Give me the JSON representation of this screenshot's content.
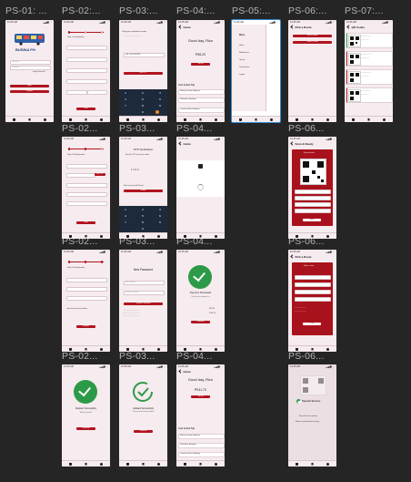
{
  "columns": [
    {
      "label": "PS-01: ..."
    },
    {
      "label": "PS-02:..."
    },
    {
      "label": "PS-03:..."
    },
    {
      "label": "PS-04:..."
    },
    {
      "label": "PS-05:..."
    },
    {
      "label": "PS-06:..."
    },
    {
      "label": "PS-07:..."
    }
  ],
  "row_labels": {
    "r2c2": "PS-02...",
    "r2c3": "PS-03...",
    "r2c4": "PS-04...",
    "r2c6": "PS-06...",
    "r3c2": "PS-02...",
    "r3c3": "PS-03...",
    "r3c4": "PS-04...",
    "r3c6": "PS-06...",
    "r4c2": "PS-02...",
    "r4c3": "PS-03...",
    "r4c4": "PS-04...",
    "r4c6": "PS-06..."
  },
  "status": {
    "time": "10:45 AM",
    "right": "▂▄▆ ◔"
  },
  "screens": {
    "login": {
      "brand": "BUSINA PH",
      "user_ph": "Username",
      "pass_ph": "Password",
      "forgot": "Forgot Password?",
      "login_btn": "Log in",
      "register_btn": "Register"
    },
    "reg1": {
      "title": "Step 1 of registration",
      "next": "Next"
    },
    "verify": {
      "title": "Verify your registration number",
      "code": "+63 | 912 345 6789",
      "btn": "Get OTP"
    },
    "home1": {
      "greet": "Good day, Rico",
      "balance": "₱35.20",
      "topup": "Top up",
      "trips": "Your Active Trip",
      "trip1": "Starting Location: Bagtasan",
      "trip2": "Destination: Bambang",
      "trip3": "Current location: Bambang"
    },
    "menu": {
      "title": "Menu",
      "items": [
        "Home",
        "Notifications",
        "Top Up",
        "Transactions",
        "Logout"
      ]
    },
    "pickone": {
      "title": "Pick a Route",
      "btn1": "Pick a Route",
      "btn2": "Scan a Ticket"
    },
    "qrlist": {
      "title": "QR Codes"
    },
    "reg2": {
      "title": "Step 2 of Registration",
      "otp": "Get OTP",
      "next": "Next"
    },
    "otp": {
      "title": "OTP Verification",
      "sub": "Enter the OTP sent to your number",
      "digits": "1  2  3  4",
      "btn": "Submit",
      "resend": "Didn't receive the code? Resend"
    },
    "loading": {
      "title": "Home"
    },
    "scan": {
      "title": "Scan & Ready",
      "panel": "Scan the ticket",
      "btn": "Next"
    },
    "reg3": {
      "title": "Step 3 of Registration",
      "terms": "I agree to the terms and conditions",
      "btn": "Register"
    },
    "newpass": {
      "title": "New Password",
      "new_ph": "New Password",
      "confirm_ph": "Confirm Password",
      "btn": "Update Password"
    },
    "paysuccess": {
      "title": "Payment Successful",
      "sub": "Thank you for riding with us",
      "amount": "₱35.20",
      "remaining": "₱241.70",
      "btn": "Continue"
    },
    "route": {
      "title": "Pick a Route",
      "panel": "Select a route",
      "btn": "Pay"
    },
    "regsuccess": {
      "title": "Register Successfully",
      "sub": "Welcome aboard!",
      "btn": "Continue"
    },
    "updated": {
      "title": "Updated Successfully",
      "sub": "Your password has been updated",
      "btn": "Continue"
    },
    "home2": {
      "greet": "Good day, Rico",
      "balance": "₱241.70",
      "topup": "Top up",
      "trips": "Your Active Trip",
      "trip1": "Starting Location: Bagtasan",
      "trip2": "Destination: Bambang",
      "trip3": "Current Location: Bambang"
    },
    "paysuccess2": {
      "title": "Payment Success",
      "sub": "Show this to the conductor",
      "note": "Show to conductor before entering"
    }
  }
}
